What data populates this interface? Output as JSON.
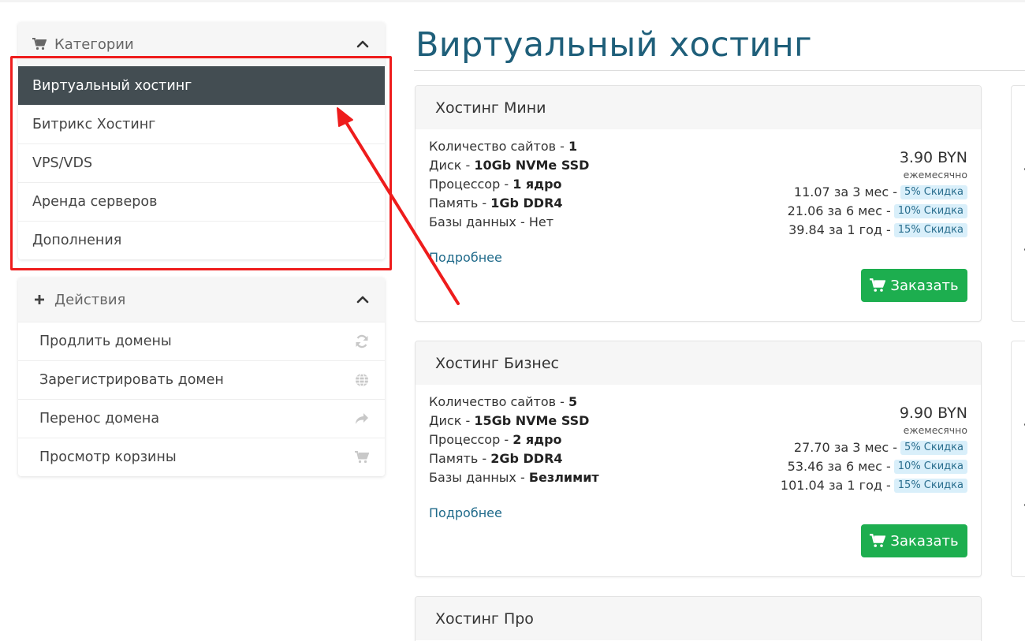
{
  "sidebar": {
    "categories": {
      "title": "Категории",
      "items": [
        {
          "label": "Виртуальный хостинг",
          "active": true
        },
        {
          "label": "Битрикс Хостинг",
          "active": false
        },
        {
          "label": "VPS/VDS",
          "active": false
        },
        {
          "label": "Аренда серверов",
          "active": false
        },
        {
          "label": "Дополнения",
          "active": false
        }
      ]
    },
    "actions": {
      "title": "Действия",
      "items": [
        {
          "label": "Продлить домены",
          "icon": "refresh-icon"
        },
        {
          "label": "Зарегистрировать домен",
          "icon": "globe-icon"
        },
        {
          "label": "Перенос домена",
          "icon": "share-arrow-icon"
        },
        {
          "label": "Просмотр корзины",
          "icon": "cart-icon"
        }
      ]
    }
  },
  "main": {
    "title": "Виртуальный хостинг",
    "products": [
      {
        "name": "Хостинг Мини",
        "features": [
          {
            "label": "Количество сайтов",
            "value": "1"
          },
          {
            "label": "Диск",
            "value": "10Gb NVMe SSD"
          },
          {
            "label": "Процессор",
            "value": "1 ядро"
          },
          {
            "label": "Память",
            "value": "1Gb DDR4"
          },
          {
            "label": "Базы данных",
            "value": "Нет"
          }
        ],
        "more_link": "Подробнее",
        "price": "3.90 BYN",
        "cycle": "ежемесячно",
        "prices": [
          {
            "text": "11.07 за 3 мес -",
            "badge": "5% Скидка"
          },
          {
            "text": "21.06 за 6 мес -",
            "badge": "10% Скидка"
          },
          {
            "text": "39.84 за 1 год -",
            "badge": "15% Скидка"
          }
        ],
        "order_label": "Заказать"
      },
      {
        "name": "Хостинг Бизнес",
        "features": [
          {
            "label": "Количество сайтов",
            "value": "5"
          },
          {
            "label": "Диск",
            "value": "15Gb NVMe SSD"
          },
          {
            "label": "Процессор",
            "value": "2 ядро"
          },
          {
            "label": "Память",
            "value": "2Gb DDR4"
          },
          {
            "label": "Базы данных",
            "value": "Безлимит"
          }
        ],
        "more_link": "Подробнее",
        "price": "9.90 BYN",
        "cycle": "ежемесячно",
        "prices": [
          {
            "text": "27.70 за 3 мес -",
            "badge": "5% Скидка"
          },
          {
            "text": "53.46 за 6 мес -",
            "badge": "10% Скидка"
          },
          {
            "text": "101.04 за 1 год -",
            "badge": "15% Скидка"
          }
        ],
        "order_label": "Заказать"
      },
      {
        "name": "Хостинг Про"
      }
    ]
  },
  "colors": {
    "accent_title": "#1f5f7a",
    "active_item_bg": "#434d52",
    "order_button": "#1dae4f",
    "badge_bg": "#d9effa",
    "annotation_red": "#ee1c1c"
  }
}
